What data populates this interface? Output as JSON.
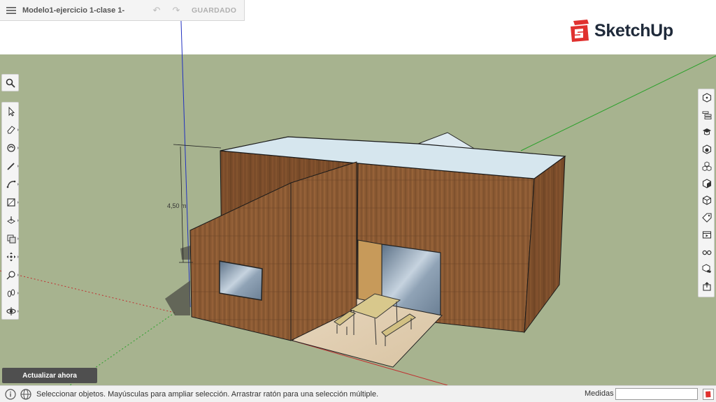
{
  "app": {
    "document_title": "Modelo1-ejercicio 1-clase 1-",
    "save_status": "GUARDADO",
    "brand": "SketchUp"
  },
  "colors": {
    "ground": "#a7b38f",
    "sky": "#ffffff",
    "wood": "#8b5a33",
    "roof": "#d6e6ee",
    "axis_red": "#c03030",
    "axis_green": "#2aa02a",
    "axis_blue": "#2030c0",
    "brand_red": "#e0312f"
  },
  "model": {
    "dimension_label": "4,50 m"
  },
  "left_toolbar": {
    "search": "search-icon",
    "tools": [
      "select-icon",
      "eraser-icon",
      "paint-bucket-icon",
      "pencil-icon",
      "arc-icon",
      "rectangle-icon",
      "push-pull-icon",
      "offset-icon",
      "move-icon",
      "tape-measure-icon",
      "walk-icon",
      "orbit-icon"
    ]
  },
  "right_toolbar": {
    "panels": [
      "entity-info-icon",
      "outliner-icon",
      "instructor-icon",
      "materials-icon",
      "components-icon",
      "styles-icon",
      "layers-icon",
      "tags-icon",
      "scenes-icon",
      "display-icon",
      "shadows-icon",
      "export-icon"
    ]
  },
  "update_button": {
    "label": "Actualizar ahora"
  },
  "statusbar": {
    "message": "Seleccionar objetos. Mayúsculas para ampliar selección. Arrastrar ratón para una selección múltiple.",
    "measurements_label": "Medidas",
    "measurements_value": ""
  }
}
